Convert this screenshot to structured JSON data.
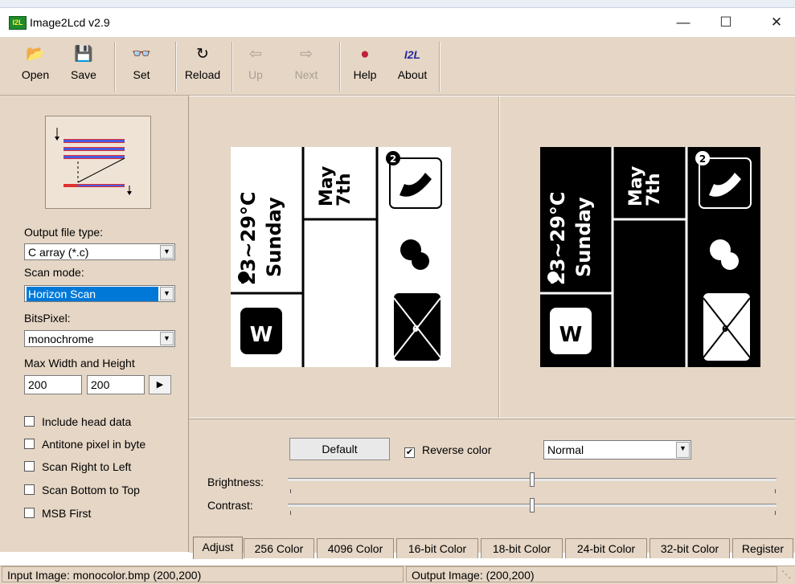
{
  "window": {
    "title": "Image2Lcd v2.9",
    "icon_text": "I2L",
    "controls": {
      "minimize": "—",
      "maximize": "☐",
      "close": "✕"
    }
  },
  "toolbar": {
    "open": "Open",
    "save": "Save",
    "set": "Set",
    "reload": "Reload",
    "up": "Up",
    "next": "Next",
    "help": "Help",
    "about": "About",
    "about_icon": "I2L"
  },
  "left": {
    "output_label": "Output file type:",
    "output_value": "C array (*.c)",
    "scan_label": "Scan mode:",
    "scan_value": "Horizon Scan",
    "bits_label": "BitsPixel:",
    "bits_value": "monochrome",
    "max_label": "Max Width and Height",
    "width": "200",
    "height": "200",
    "checkboxes": [
      {
        "label": "Include head data",
        "checked": false
      },
      {
        "label": "Antitone pixel in byte",
        "checked": false
      },
      {
        "label": "Scan Right to Left",
        "checked": false
      },
      {
        "label": "Scan Bottom to Top",
        "checked": false
      },
      {
        "label": "MSB First",
        "checked": false
      }
    ]
  },
  "preview": {
    "temp": "23~29°C",
    "day": "Sunday",
    "month": "May",
    "date": "7th",
    "badge": "2",
    "mail": "6",
    "logo": "W"
  },
  "adjust": {
    "default_label": "Default",
    "reverse_label": "Reverse color",
    "reverse_checked": true,
    "mode_value": "Normal",
    "brightness_label": "Brightness:",
    "contrast_label": "Contrast:",
    "brightness_level": 0.5,
    "contrast_level": 0.5
  },
  "tabs": [
    "Adjust",
    "256 Color",
    "4096 Color",
    "16-bit Color",
    "18-bit Color",
    "24-bit Color",
    "32-bit Color",
    "Register"
  ],
  "status": {
    "input": "Input Image: monocolor.bmp (200,200)",
    "output": "Output Image: (200,200)"
  },
  "colors": {
    "panel": "#e5d6c5",
    "selection": "#0078d7"
  }
}
